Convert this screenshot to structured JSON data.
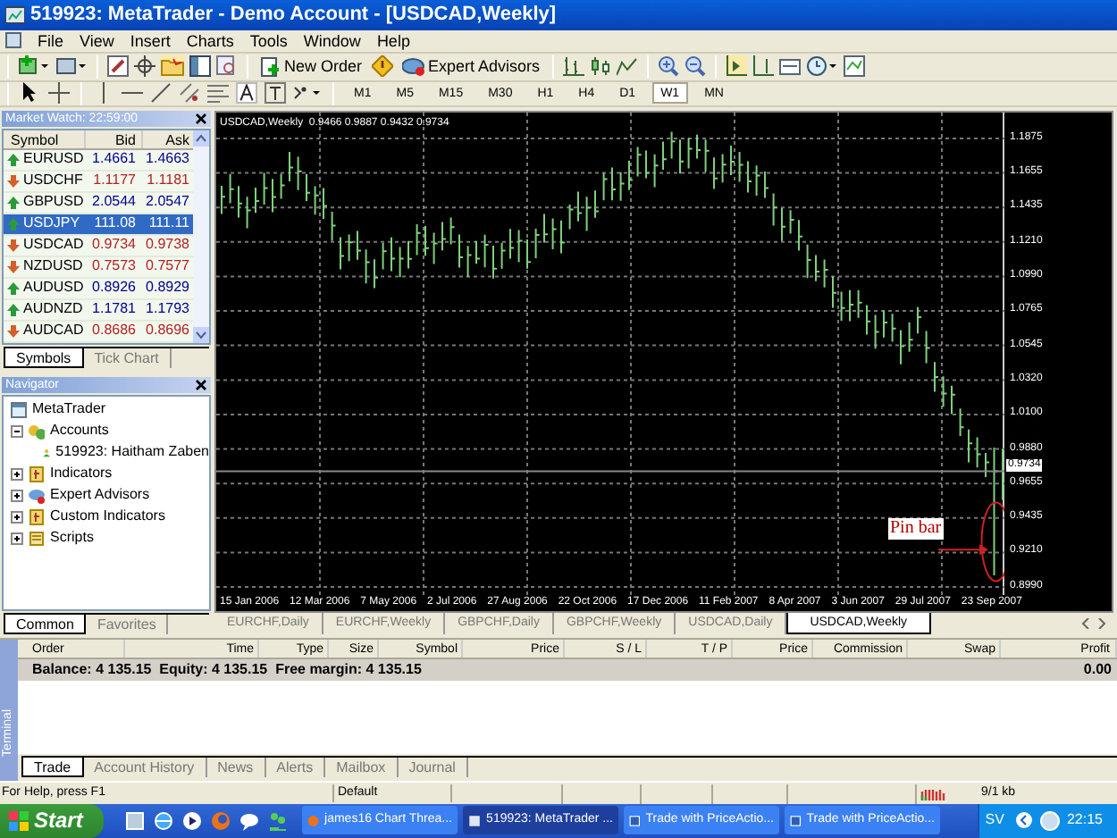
{
  "window": {
    "title": "519923: MetaTrader - Demo Account - [USDCAD,Weekly]"
  },
  "menu": [
    "File",
    "View",
    "Insert",
    "Charts",
    "Tools",
    "Window",
    "Help"
  ],
  "toolbar": {
    "buttons": [
      "New Order",
      "Expert Advisors"
    ]
  },
  "timeframes": [
    {
      "label": "M1",
      "selected": false
    },
    {
      "label": "M5",
      "selected": false
    },
    {
      "label": "M15",
      "selected": false
    },
    {
      "label": "M30",
      "selected": false
    },
    {
      "label": "H1",
      "selected": false
    },
    {
      "label": "H4",
      "selected": false
    },
    {
      "label": "D1",
      "selected": false
    },
    {
      "label": "W1",
      "selected": true
    },
    {
      "label": "MN",
      "selected": false
    }
  ],
  "market_watch": {
    "title": "Market Watch: 22:59:00",
    "columns": [
      "Symbol",
      "Bid",
      "Ask"
    ],
    "rows": [
      {
        "symbol": "EURUSD",
        "bid": "1.4661",
        "ask": "1.4663",
        "up": true,
        "selected": false
      },
      {
        "symbol": "USDCHF",
        "bid": "1.1177",
        "ask": "1.1181",
        "up": false,
        "selected": false
      },
      {
        "symbol": "GBPUSD",
        "bid": "2.0544",
        "ask": "2.0547",
        "up": true,
        "selected": false
      },
      {
        "symbol": "USDJPY",
        "bid": "111.08",
        "ask": "111.11",
        "up": true,
        "selected": true
      },
      {
        "symbol": "USDCAD",
        "bid": "0.9734",
        "ask": "0.9738",
        "up": false,
        "selected": false
      },
      {
        "symbol": "NZDUSD",
        "bid": "0.7573",
        "ask": "0.7577",
        "up": false,
        "selected": false
      },
      {
        "symbol": "AUDUSD",
        "bid": "0.8926",
        "ask": "0.8929",
        "up": true,
        "selected": false
      },
      {
        "symbol": "AUDNZD",
        "bid": "1.1781",
        "ask": "1.1793",
        "up": true,
        "selected": false
      },
      {
        "symbol": "AUDCAD",
        "bid": "0.8686",
        "ask": "0.8696",
        "up": false,
        "selected": false
      }
    ],
    "tabs": [
      {
        "label": "Symbols",
        "selected": true
      },
      {
        "label": "Tick Chart",
        "selected": false
      }
    ]
  },
  "navigator": {
    "title": "Navigator",
    "root": "MetaTrader",
    "items": [
      {
        "label": "Accounts",
        "expanded": true,
        "children": [
          {
            "label": "519923: Haitham Zaben"
          }
        ]
      },
      {
        "label": "Indicators",
        "expanded": false
      },
      {
        "label": "Expert Advisors",
        "expanded": false
      },
      {
        "label": "Custom Indicators",
        "expanded": false
      },
      {
        "label": "Scripts",
        "expanded": false
      }
    ],
    "tabs": [
      {
        "label": "Common",
        "selected": true
      },
      {
        "label": "Favorites",
        "selected": false
      }
    ]
  },
  "chart": {
    "header": "USDCAD,Weekly  0.9466 0.9887 0.9432 0.9734",
    "price_labels": [
      "1.1875",
      "1.1655",
      "1.1435",
      "1.1210",
      "1.0990",
      "1.0765",
      "1.0545",
      "1.0320",
      "1.0100",
      "0.9880",
      "0.9655",
      "0.9435",
      "0.9210",
      "0.8990"
    ],
    "current_price": "0.9734",
    "date_labels": [
      "15 Jan 2006",
      "12 Mar 2006",
      "7 May 2006",
      "2 Jul 2006",
      "27 Aug 2006",
      "22 Oct 2006",
      "17 Dec 2006",
      "11 Feb 2007",
      "8 Apr 2007",
      "3 Jun 2007",
      "29 Jul 2007",
      "23 Sep 2007"
    ],
    "annotation": "Pin bar"
  },
  "chart_tabs": [
    {
      "label": "EURCHF,Daily",
      "selected": false
    },
    {
      "label": "EURCHF,Weekly",
      "selected": false
    },
    {
      "label": "GBPCHF,Daily",
      "selected": false
    },
    {
      "label": "GBPCHF,Weekly",
      "selected": false
    },
    {
      "label": "USDCAD,Daily",
      "selected": false
    },
    {
      "label": "USDCAD,Weekly",
      "selected": true
    }
  ],
  "terminal": {
    "side_label": "Terminal",
    "columns": [
      "Order",
      "Time",
      "Type",
      "Size",
      "Symbol",
      "Price",
      "S / L",
      "T / P",
      "Price",
      "Commission",
      "Swap",
      "Profit"
    ],
    "balance": "Balance: 4 135.15  Equity: 4 135.15  Free margin: 4 135.15",
    "profit": "0.00",
    "tabs": [
      {
        "label": "Trade",
        "selected": true
      },
      {
        "label": "Account History",
        "selected": false
      },
      {
        "label": "News",
        "selected": false
      },
      {
        "label": "Alerts",
        "selected": false
      },
      {
        "label": "Mailbox",
        "selected": false
      },
      {
        "label": "Journal",
        "selected": false
      }
    ]
  },
  "status_bar": {
    "help": "For Help, press F1",
    "profile": "Default",
    "traffic": "9/1 kb"
  },
  "taskbar": {
    "start": "Start",
    "tasks": [
      {
        "label": "james16 Chart Threa...",
        "selected": false
      },
      {
        "label": "519923: MetaTrader ...",
        "selected": true
      },
      {
        "label": "Trade with PriceActio...",
        "selected": false
      },
      {
        "label": "Trade with PriceActio...",
        "selected": false
      }
    ],
    "tray_text": "SV",
    "clock": "22:15"
  }
}
